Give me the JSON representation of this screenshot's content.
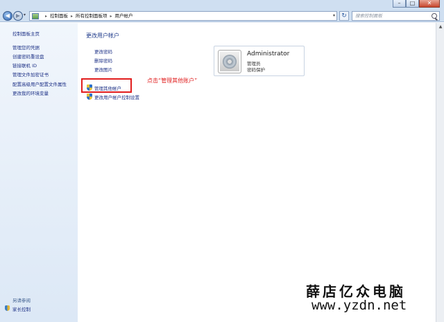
{
  "window": {
    "minimize_label": "–",
    "maximize_label": "□",
    "close_label": "✕"
  },
  "nav": {
    "back_label": "◀",
    "forward_label": "▶",
    "breadcrumbs": [
      "控制面板",
      "所有控制面板项",
      "用户帐户"
    ],
    "search_placeholder": "搜索控制面板"
  },
  "sidebar": {
    "home": "控制面板主页",
    "items": [
      "管理您的凭据",
      "创建密码重设盘",
      "链接联机 ID",
      "管理文件加密证书",
      "配置高级用户配置文件属性",
      "更改我的环境变量"
    ],
    "see_also": "另请参阅",
    "family": "家长控制"
  },
  "main": {
    "title": "更改用户帐户",
    "links": [
      "更改密码",
      "删除密码",
      "更改图片"
    ],
    "manage_other": "管理其他帐户",
    "uac_settings": "更改用户帐户控制设置",
    "annotation": "点击“管理其他账户”"
  },
  "account": {
    "name": "Administrator",
    "role": "管理员",
    "status": "密码保护"
  },
  "watermark": {
    "name": "薛店亿众电脑",
    "url": "www.yzdn.net"
  },
  "icons": {
    "control-panel": "control-panel-icon",
    "shield": "uac-shield-icon",
    "family": "family-safety-icon",
    "search": "search-icon",
    "refresh": "refresh-icon"
  },
  "colors": {
    "link": "#1e3287",
    "annotation": "#e02020",
    "highlight_box": "#e11d1d",
    "chrome": "#cfdff1"
  }
}
